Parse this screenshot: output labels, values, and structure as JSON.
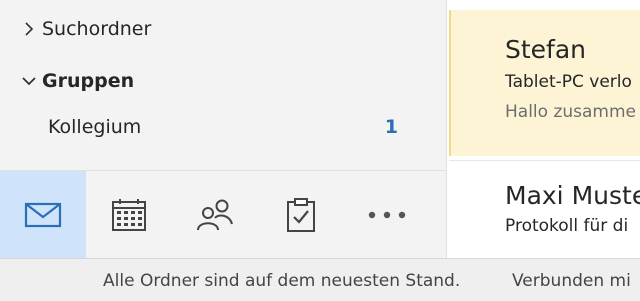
{
  "folders": {
    "suchordner": "Suchordner",
    "gruppen": "Gruppen",
    "kollegium": {
      "label": "Kollegium",
      "count": "1"
    }
  },
  "modules": [
    {
      "name": "mail-icon",
      "active": true
    },
    {
      "name": "calendar-icon",
      "active": false
    },
    {
      "name": "people-icon",
      "active": false
    },
    {
      "name": "tasks-icon",
      "active": false
    },
    {
      "name": "more-icon",
      "active": false
    }
  ],
  "messages": [
    {
      "sender": "Stefan",
      "subject": "Tablet-PC verlo",
      "preview": "Hallo zusamme"
    },
    {
      "sender": "Maxi Muste",
      "subject": "Protokoll für di",
      "preview": ""
    }
  ],
  "status": {
    "left": "Alle Ordner sind auf dem neuesten Stand.",
    "right": "Verbunden mi"
  },
  "colors": {
    "accent": "#2b6fb6",
    "active_module_bg": "#cfe4fa",
    "selected_message_bg": "#fdf4d6"
  }
}
